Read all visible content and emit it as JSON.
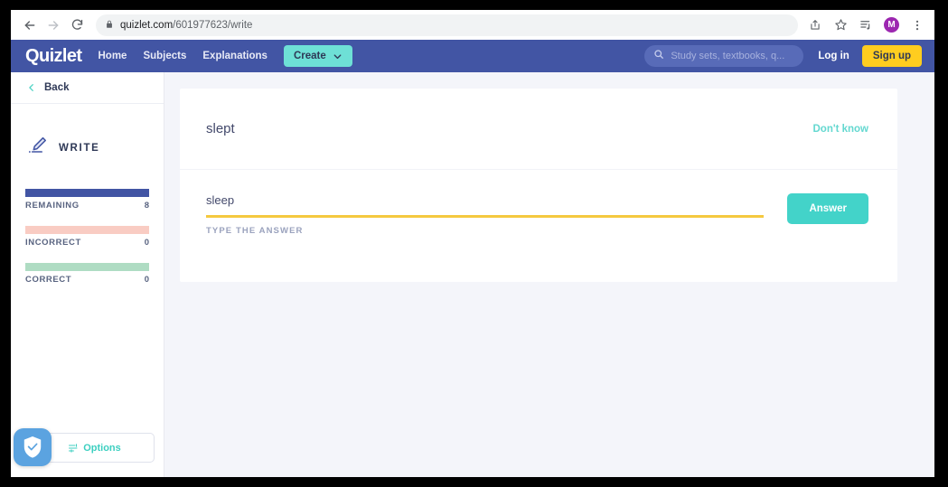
{
  "browser": {
    "back_icon": "arrow-left-icon",
    "forward_icon": "arrow-right-icon",
    "reload_icon": "reload-icon",
    "lock_icon": "lock-icon",
    "url_host": "quizlet.com",
    "url_path": "/601977623/write",
    "share_icon": "share-icon",
    "bookmark_icon": "star-icon",
    "reading_list_icon": "reading-list-icon",
    "avatar_initial": "M",
    "avatar_color": "#9c27b0",
    "menu_icon": "three-dot-menu-icon"
  },
  "site_nav": {
    "logo": "Quizlet",
    "links": [
      {
        "label": "Home"
      },
      {
        "label": "Subjects"
      },
      {
        "label": "Explanations"
      }
    ],
    "create_label": "Create",
    "create_caret_icon": "chevron-down-icon",
    "search_icon": "search-icon",
    "search_placeholder": "Study sets, textbooks, q...",
    "login_label": "Log in",
    "signup_label": "Sign up",
    "nav_color": "#4255a4",
    "create_color": "#6ee0d6",
    "signup_color": "#ffcd1f"
  },
  "sidebar": {
    "back_label": "Back",
    "back_icon": "chevron-left-icon",
    "mode_icon": "pencil-write-icon",
    "mode_label": "WRITE",
    "stats": [
      {
        "label": "REMAINING",
        "value": "8",
        "color": "#4255a4"
      },
      {
        "label": "INCORRECT",
        "value": "0",
        "color": "#f9ccc3"
      },
      {
        "label": "CORRECT",
        "value": "0",
        "color": "#afdcc3"
      }
    ],
    "options_label": "Options",
    "options_icon": "sliders-icon",
    "shield_badge_icon": "shield-check-icon"
  },
  "card": {
    "term": "slept",
    "dont_know_label": "Don't know",
    "answer_value": "sleep",
    "answer_placeholder": "Type the answer",
    "answer_hint": "TYPE THE ANSWER",
    "answer_button_label": "Answer",
    "underline_color": "#f5c93f",
    "button_color": "#43d3c9"
  }
}
